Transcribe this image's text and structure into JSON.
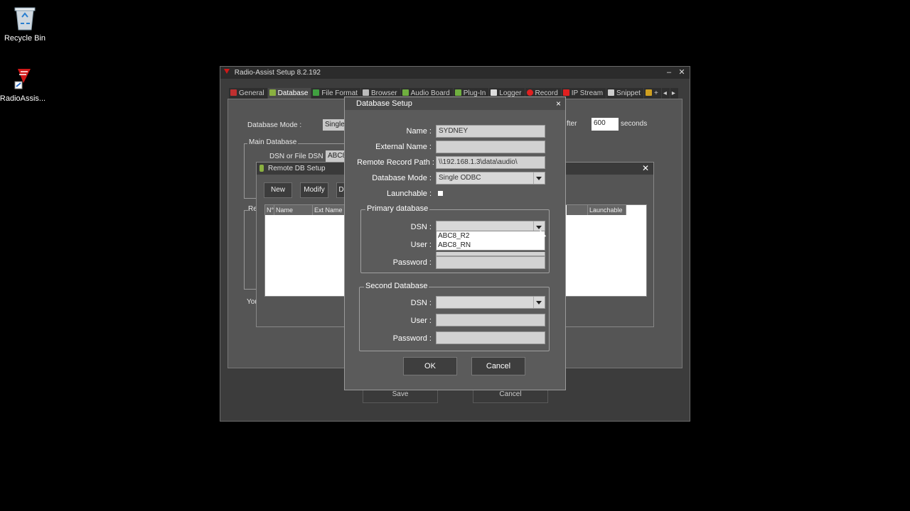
{
  "desktop": {
    "recycle_bin": "Recycle Bin",
    "radioassist": "RadioAssis..."
  },
  "main_window": {
    "title": "Radio-Assist Setup 8.2.192",
    "tabs": [
      "General",
      "Database",
      "File Format",
      "Browser",
      "Audio Board",
      "Plug-In",
      "Logger",
      "Record",
      "IP Stream",
      "Snippet"
    ],
    "tab_more": "+",
    "database_mode_label": "Database Mode :",
    "database_mode_value": "Single",
    "after_label": "fter",
    "after_value": "600",
    "seconds_label": "seconds",
    "main_database_label": "Main Database",
    "dsn_label": "DSN or File DSN",
    "dsn_value": "ABC8",
    "re_label": "Re",
    "you_label": "You",
    "save_label": "Save",
    "cancel_label": "Cancel"
  },
  "remote_db": {
    "title": "Remote DB Setup",
    "new_label": "New",
    "modify_label": "Modify",
    "delete_label": "D",
    "columns": [
      "N°",
      "Name",
      "Ext Name"
    ],
    "launchable_col": "Launchable"
  },
  "dialog": {
    "title": "Database Setup",
    "close": "×",
    "name_label": "Name :",
    "name_value": "SYDNEY",
    "external_name_label": "External Name :",
    "external_name_value": "",
    "remote_path_label": "Remote Record Path :",
    "remote_path_value": "\\\\192.168.1.3\\data\\audio\\",
    "db_mode_label": "Database Mode :",
    "db_mode_value": "Single ODBC",
    "launchable_label": "Launchable :",
    "primary_label": "Primary database",
    "primary_dsn_label": "DSN :",
    "primary_dsn_value": "",
    "primary_user_label": "User :",
    "primary_password_label": "Password :",
    "dsn_options": [
      "ABC8_R2",
      "ABC8_RN"
    ],
    "second_label": "Second Database",
    "second_dsn_label": "DSN :",
    "second_user_label": "User :",
    "second_password_label": "Password :",
    "ok_label": "OK",
    "cancel_label": "Cancel"
  }
}
